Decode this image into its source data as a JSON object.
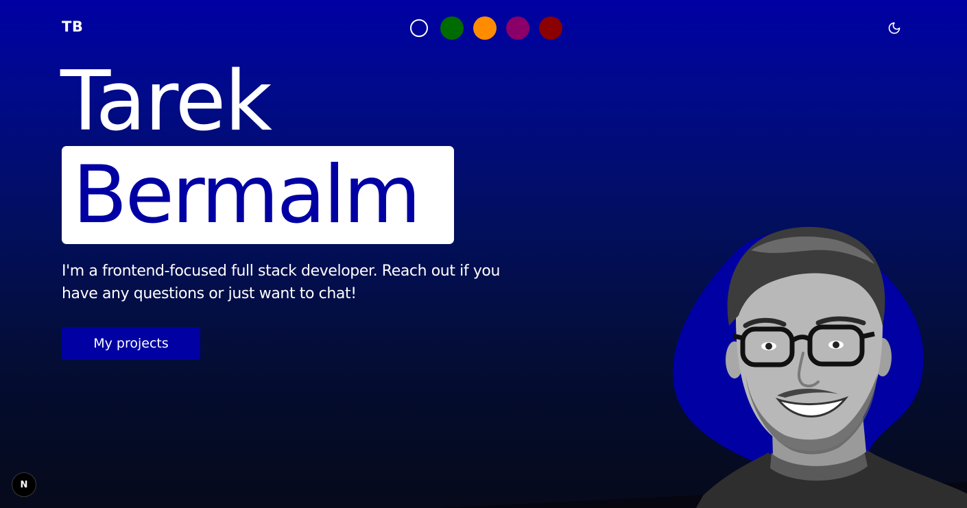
{
  "header": {
    "logo": "TB",
    "theme_swatches": [
      {
        "name": "default",
        "color": "#0000a3",
        "active": true
      },
      {
        "name": "green",
        "color": "#006b00",
        "active": false
      },
      {
        "name": "orange",
        "color": "#ff8c00",
        "active": false
      },
      {
        "name": "purple",
        "color": "#8b0068",
        "active": false
      },
      {
        "name": "red",
        "color": "#8b0000",
        "active": false
      }
    ],
    "theme_toggle_icon": "moon-icon"
  },
  "hero": {
    "first_name": "Tarek",
    "last_name": "Bermalm",
    "intro": "I'm a frontend-focused full stack developer. Reach out if you have any questions or just want to chat!",
    "cta_label": "My projects"
  },
  "portrait": {
    "icon": "profile-photo",
    "blob_color": "#0000a3"
  },
  "devtools": {
    "label": "N",
    "icon": "nextjs-icon"
  },
  "colors": {
    "accent": "#0000a3",
    "text": "#ffffff",
    "background_bottom": "#060a1a"
  }
}
